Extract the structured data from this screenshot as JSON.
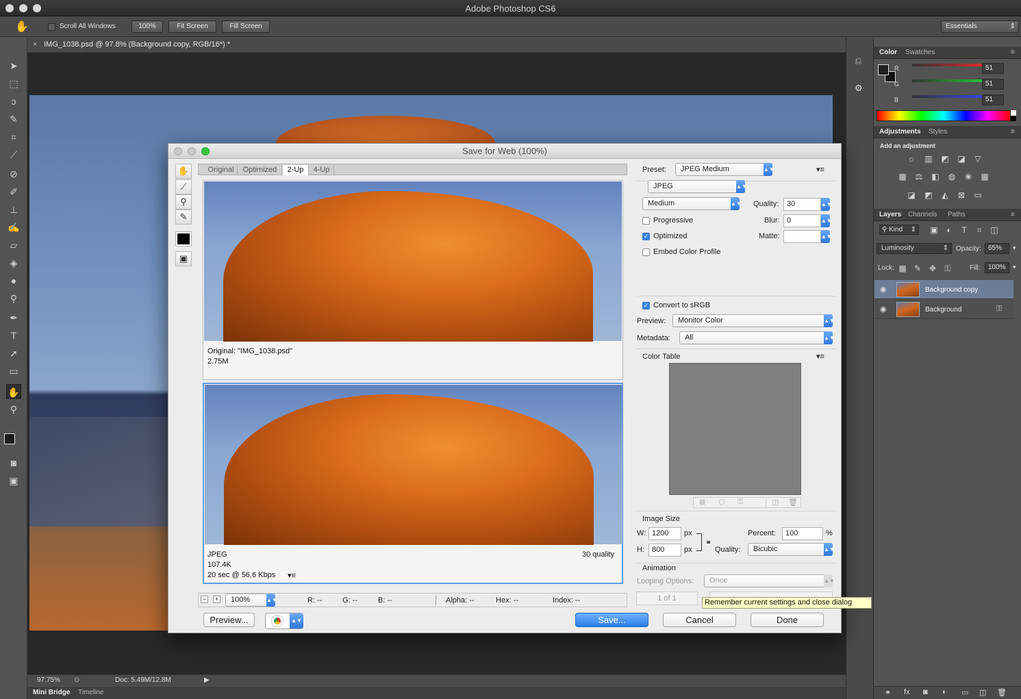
{
  "app": {
    "title": "Adobe Photoshop CS6"
  },
  "options_bar": {
    "scroll_all_windows": "Scroll All Windows",
    "zoom_100": "100%",
    "fit_screen": "Fit Screen",
    "fill_screen": "Fill Screen",
    "workspace": "Essentials"
  },
  "document": {
    "tab_title": "IMG_1038.psd @ 97.8% (Background copy, RGB/16*) *",
    "zoom": "97.75%",
    "doc_size": "Doc: 5.49M/12.8M"
  },
  "bottom_tabs": [
    "Mini Bridge",
    "Timeline"
  ],
  "panels": {
    "color": {
      "tabs": [
        "Color",
        "Swatches"
      ],
      "channels": [
        {
          "label": "R",
          "value": "51"
        },
        {
          "label": "G",
          "value": "51"
        },
        {
          "label": "B",
          "value": "51"
        }
      ]
    },
    "adjustments": {
      "tabs": [
        "Adjustments",
        "Styles"
      ],
      "header": "Add an adjustment"
    },
    "layers": {
      "tabs": [
        "Layers",
        "Channels",
        "Paths"
      ],
      "kind": "Kind",
      "blend_mode": "Luminosity",
      "opacity_label": "Opacity:",
      "opacity": "65%",
      "lock_label": "Lock:",
      "fill_label": "Fill:",
      "fill": "100%",
      "items": [
        {
          "name": "Background copy"
        },
        {
          "name": "Background"
        }
      ]
    }
  },
  "dialog": {
    "title": "Save for Web (100%)",
    "view_tabs": [
      "Original",
      "Optimized",
      "2-Up",
      "4-Up"
    ],
    "original_pane": {
      "line1": "Original: \"IMG_1038.psd\"",
      "line2": "2.75M"
    },
    "optimized_pane": {
      "format": "JPEG",
      "size": "107.4K",
      "time": "20 sec @ 56.6 Kbps",
      "quality": "30 quality"
    },
    "settings": {
      "preset_label": "Preset:",
      "preset": "JPEG Medium",
      "format": "JPEG",
      "compression": "Medium",
      "quality_label": "Quality:",
      "quality": "30",
      "progressive": "Progressive",
      "blur_label": "Blur:",
      "blur": "0",
      "optimized": "Optimized",
      "matte_label": "Matte:",
      "embed_profile": "Embed Color Profile",
      "convert_srgb": "Convert to sRGB",
      "preview_label": "Preview:",
      "preview": "Monitor Color",
      "metadata_label": "Metadata:",
      "metadata": "All",
      "color_table": "Color Table",
      "image_size": "Image Size",
      "w_label": "W:",
      "width": "1200",
      "h_label": "H:",
      "height": "800",
      "px": "px",
      "percent_label": "Percent:",
      "percent": "100",
      "percent_sign": "%",
      "resample_label": "Quality:",
      "resample": "Bicubic",
      "animation": "Animation",
      "looping_label": "Looping Options:",
      "looping": "Once",
      "frame": "1 of 1"
    },
    "footer": {
      "zoom": "100%",
      "r": "R: --",
      "g": "G: --",
      "b": "B: --",
      "alpha": "Alpha: --",
      "hex": "Hex: --",
      "index": "Index: --",
      "preview_btn": "Preview...",
      "save_btn": "Save...",
      "cancel_btn": "Cancel",
      "done_btn": "Done"
    },
    "tooltip": "Remember current settings and close dialog"
  }
}
